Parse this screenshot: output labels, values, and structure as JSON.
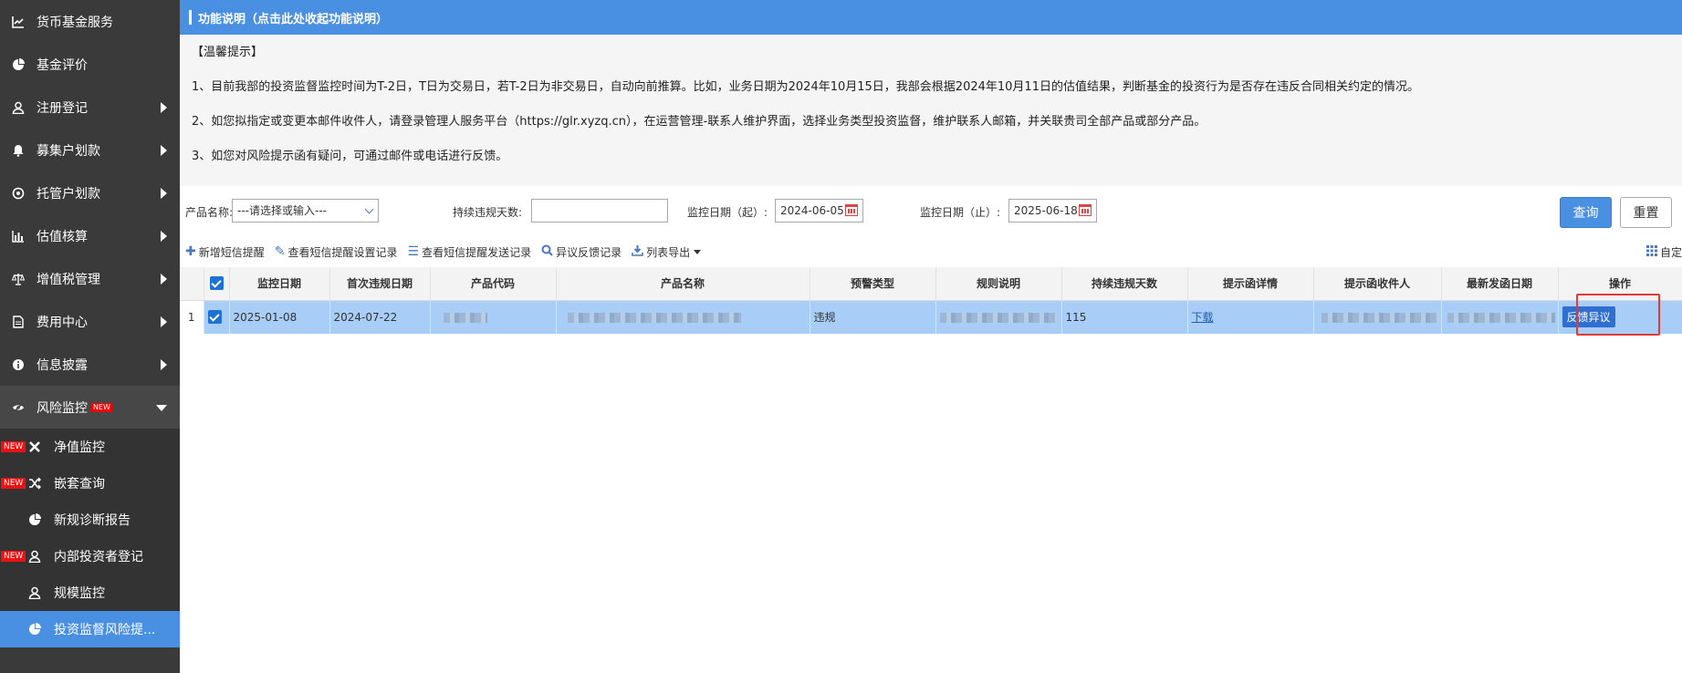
{
  "sidebar": {
    "items": [
      {
        "label": "货币基金服务",
        "icon": "chart-line-icon",
        "arrow": false
      },
      {
        "label": "基金评价",
        "icon": "pie-icon",
        "arrow": false
      },
      {
        "label": "注册登记",
        "icon": "user-icon",
        "arrow": true
      },
      {
        "label": "募集户划款",
        "icon": "bell-icon",
        "arrow": true
      },
      {
        "label": "托管户划款",
        "icon": "circle-dot-icon",
        "arrow": true
      },
      {
        "label": "估值核算",
        "icon": "bar-chart-icon",
        "arrow": true
      },
      {
        "label": "增值税管理",
        "icon": "balance-scale-icon",
        "arrow": true
      },
      {
        "label": "费用中心",
        "icon": "document-icon",
        "arrow": true
      },
      {
        "label": "信息披露",
        "icon": "info-icon",
        "arrow": true
      },
      {
        "label": "风险监控",
        "icon": "eye-slash-icon",
        "arrow": true,
        "open": true,
        "tag": "NEW"
      }
    ],
    "sub_items": [
      {
        "label": "净值监控",
        "icon": "cross-tool-icon",
        "badge": "NEW"
      },
      {
        "label": "嵌套查询",
        "icon": "shuffle-icon",
        "badge": "NEW"
      },
      {
        "label": "新规诊断报告",
        "icon": "pie-icon",
        "badge": ""
      },
      {
        "label": "内部投资者登记",
        "icon": "user-icon",
        "badge": "NEW"
      },
      {
        "label": "规模监控",
        "icon": "user-icon",
        "badge": ""
      },
      {
        "label": "投资监督风险提...",
        "icon": "pie-icon",
        "badge": "",
        "active": true
      }
    ]
  },
  "header": {
    "title": "功能说明（点击此处收起功能说明）"
  },
  "tips": {
    "heading": "【温馨提示】",
    "line1": "1、目前我部的投资监督监控时间为T-2日，T日为交易日，若T-2日为非交易日，自动向前推算。比如，业务日期为2024年10月15日，我部会根据2024年10月11日的估值结果，判断基金的投资行为是否存在违反合同相关约定的情况。",
    "line2": "2、如您拟指定或变更本邮件收件人，请登录管理人服务平台（https://glr.xyzq.cn），在运营管理-联系人维护界面，选择业务类型投资监督，维护联系人邮箱，并关联贵司全部产品或部分产品。",
    "line3": "3、如您对风险提示函有疑问，可通过邮件或电话进行反馈。"
  },
  "filters": {
    "product_label": "产品名称:",
    "product_value": "---请选择或输入---",
    "days_label": "持续违规天数:",
    "days_value": "",
    "start_label": "监控日期（起）:",
    "start_value": "2024-06-05",
    "end_label": "监控日期（止）:",
    "end_value": "2025-06-18",
    "query": "查询",
    "reset": "重置"
  },
  "toolbar": {
    "add_sms": "新增短信提醒",
    "view_sms_settings": "查看短信提醒设置记录",
    "view_sms_sent": "查看短信提醒发送记录",
    "feedback_records": "异议反馈记录",
    "export": "列表导出",
    "right_label": "自定"
  },
  "table": {
    "columns": [
      "监控日期",
      "首次违规日期",
      "产品代码",
      "产品名称",
      "预警类型",
      "规则说明",
      "持续违规天数",
      "提示函详情",
      "提示函收件人",
      "最新发函日期",
      "操作"
    ],
    "rows": [
      {
        "row_num": "1",
        "monitor_date": "2025-01-08",
        "first_violation_date": "2024-07-22",
        "alert_type": "违规",
        "days": "115",
        "detail_link": "下载",
        "action": "反馈异议"
      }
    ]
  }
}
